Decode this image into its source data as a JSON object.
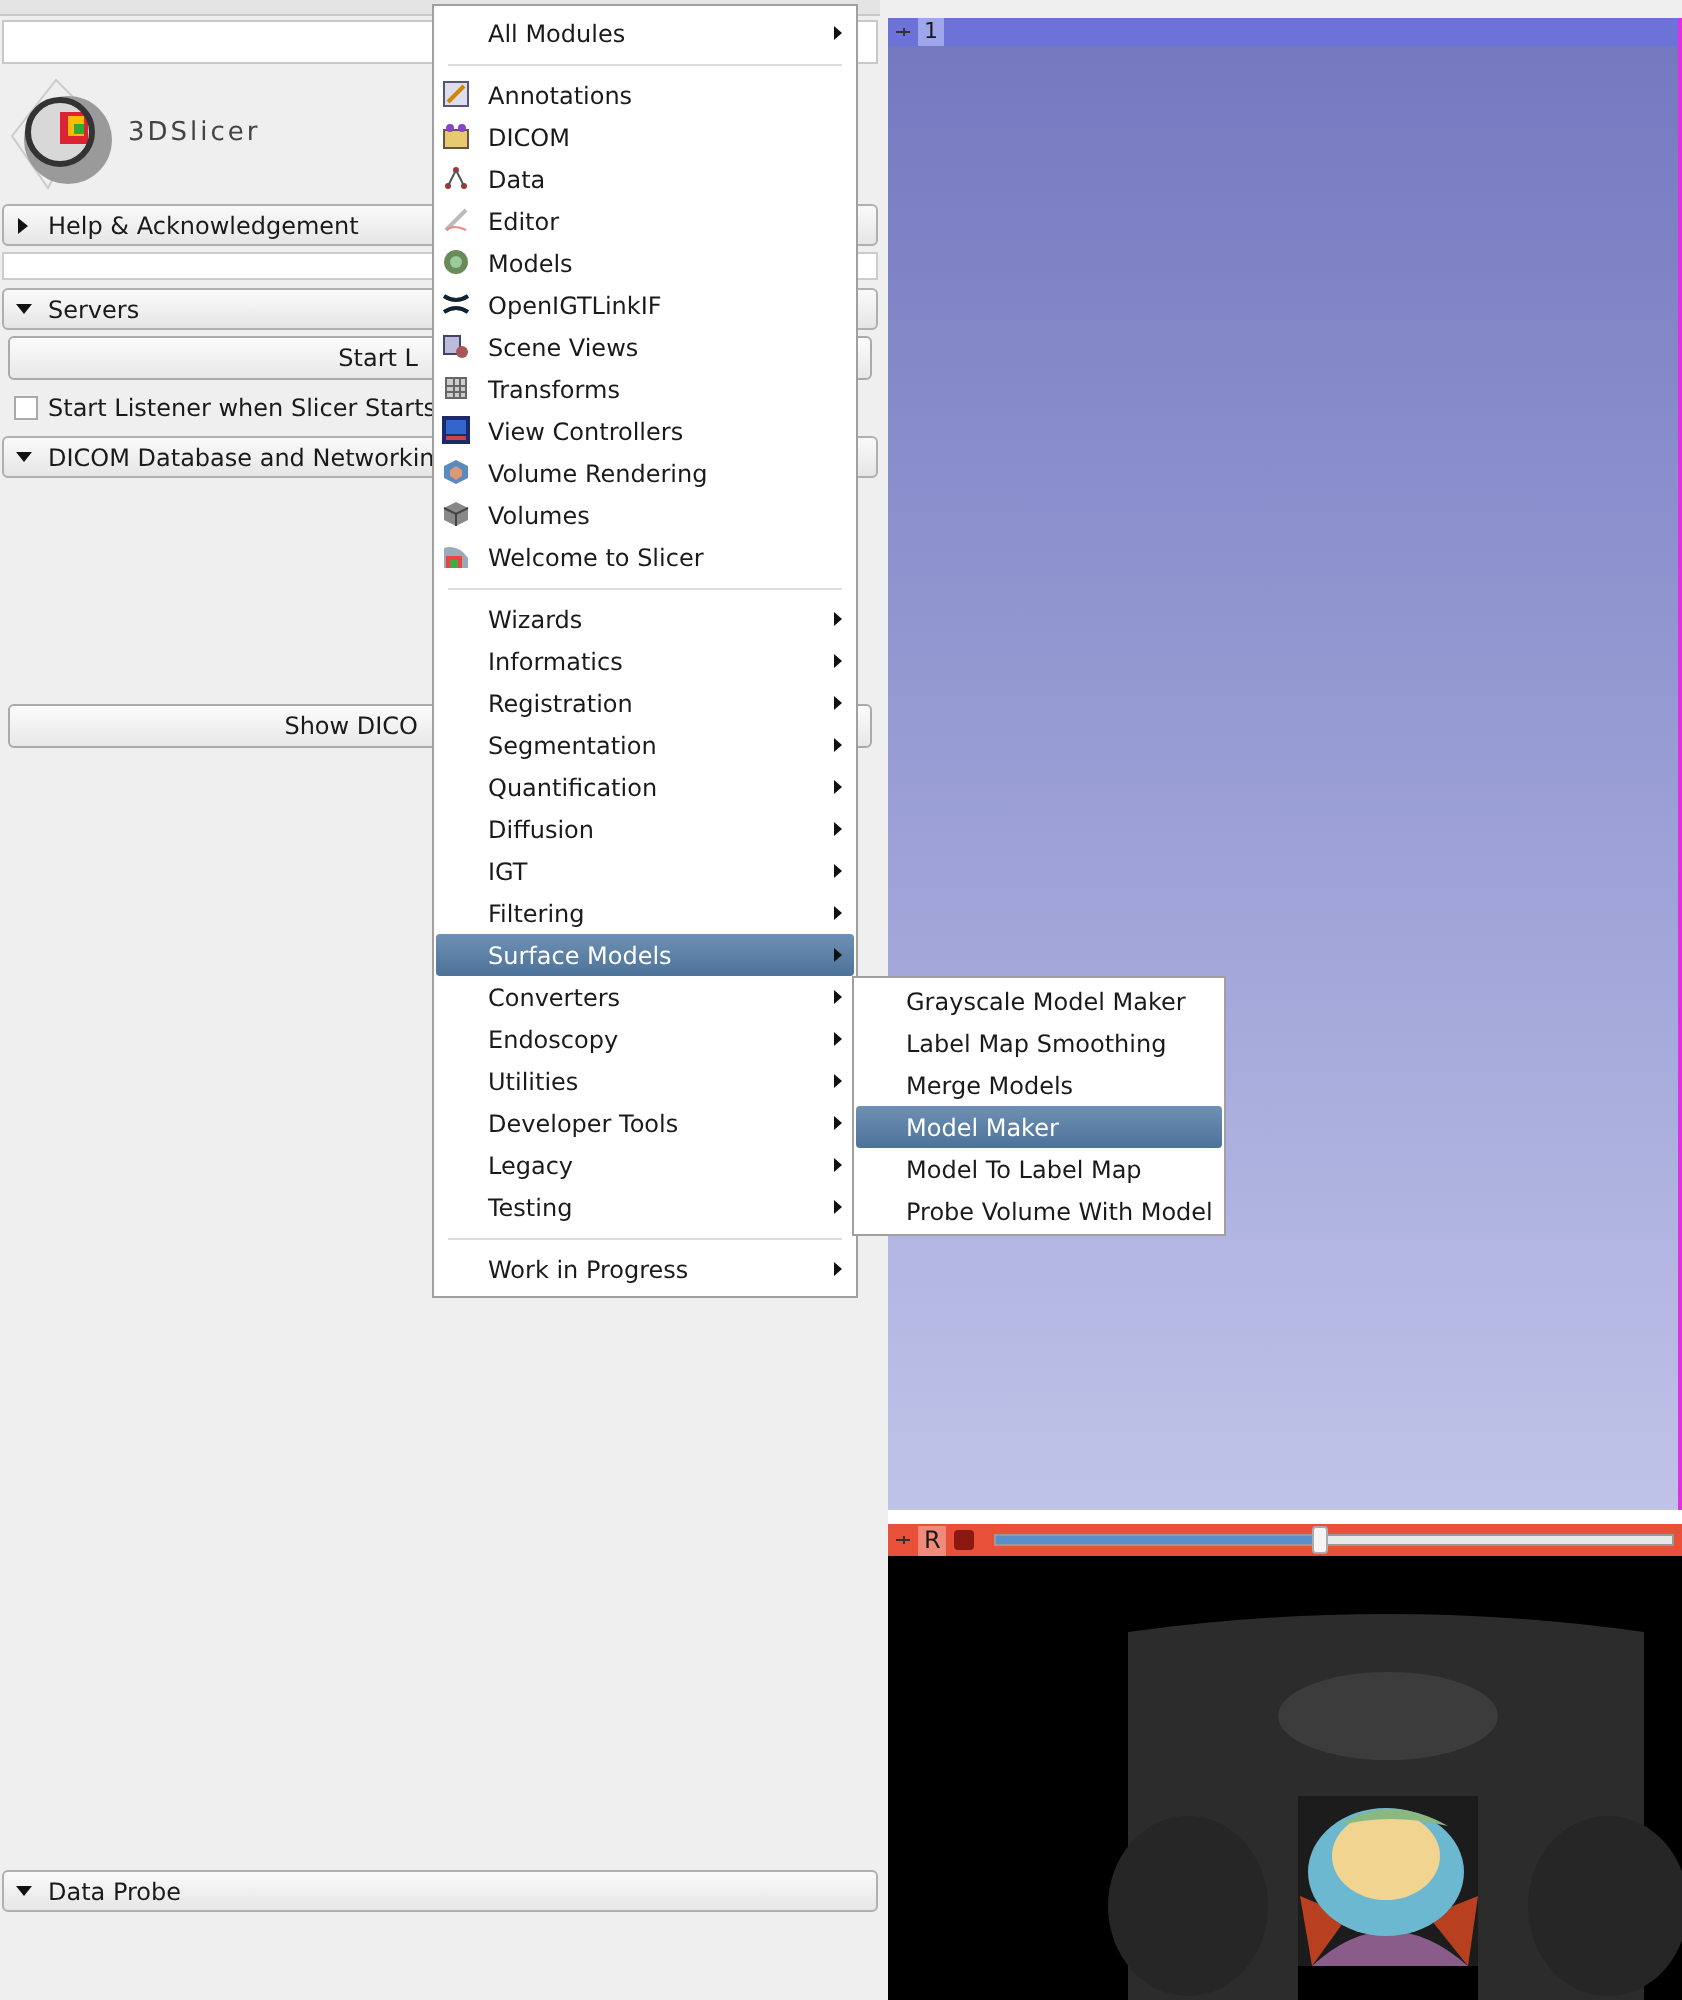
{
  "logo": {
    "text": "3DSlicer"
  },
  "panel": [
    {
      "kind": "section",
      "label": "Help & Acknowledgement",
      "expanded": false
    },
    {
      "kind": "spacer"
    },
    {
      "kind": "section",
      "label": "Servers",
      "expanded": true
    },
    {
      "kind": "button",
      "label": "Start L"
    },
    {
      "kind": "checkbox",
      "label": "Start Listener when Slicer Starts",
      "checked": false
    },
    {
      "kind": "section",
      "label": "DICOM Database and Networkin",
      "expanded": true
    },
    {
      "kind": "button",
      "label": "Show DICO"
    }
  ],
  "bottom_section": {
    "label": "Data Probe",
    "expanded": true
  },
  "menu": [
    {
      "kind": "category",
      "label": "All Modules",
      "selected": false
    },
    {
      "kind": "separator"
    },
    {
      "kind": "module",
      "label": "Annotations",
      "selected": false
    },
    {
      "kind": "module",
      "label": "DICOM",
      "selected": false
    },
    {
      "kind": "module",
      "label": "Data",
      "selected": false
    },
    {
      "kind": "module",
      "label": "Editor",
      "selected": false
    },
    {
      "kind": "module",
      "label": "Models",
      "selected": false
    },
    {
      "kind": "module",
      "label": "OpenIGTLinkIF",
      "selected": false
    },
    {
      "kind": "module",
      "label": "Scene Views",
      "selected": false
    },
    {
      "kind": "module",
      "label": "Transforms",
      "selected": false
    },
    {
      "kind": "module",
      "label": "View Controllers",
      "selected": false
    },
    {
      "kind": "module",
      "label": "Volume Rendering",
      "selected": false
    },
    {
      "kind": "module",
      "label": "Volumes",
      "selected": false
    },
    {
      "kind": "module",
      "label": "Welcome to Slicer",
      "selected": false
    },
    {
      "kind": "separator"
    },
    {
      "kind": "category",
      "label": "Wizards",
      "selected": false
    },
    {
      "kind": "category",
      "label": "Informatics",
      "selected": false
    },
    {
      "kind": "category",
      "label": "Registration",
      "selected": false
    },
    {
      "kind": "category",
      "label": "Segmentation",
      "selected": false
    },
    {
      "kind": "category",
      "label": "Quantification",
      "selected": false
    },
    {
      "kind": "category",
      "label": "Diffusion",
      "selected": false
    },
    {
      "kind": "category",
      "label": "IGT",
      "selected": false
    },
    {
      "kind": "category",
      "label": "Filtering",
      "selected": false
    },
    {
      "kind": "category",
      "label": "Surface Models",
      "selected": true
    },
    {
      "kind": "category",
      "label": "Converters",
      "selected": false
    },
    {
      "kind": "category",
      "label": "Endoscopy",
      "selected": false
    },
    {
      "kind": "category",
      "label": "Utilities",
      "selected": false
    },
    {
      "kind": "category",
      "label": "Developer Tools",
      "selected": false
    },
    {
      "kind": "category",
      "label": "Legacy",
      "selected": false
    },
    {
      "kind": "category",
      "label": "Testing",
      "selected": false
    },
    {
      "kind": "separator"
    },
    {
      "kind": "category",
      "label": "Work in Progress",
      "selected": false
    }
  ],
  "submenu": [
    {
      "label": "Grayscale Model Maker",
      "selected": false
    },
    {
      "label": "Label Map Smoothing",
      "selected": false
    },
    {
      "label": "Merge Models",
      "selected": false
    },
    {
      "label": "Model Maker",
      "selected": true
    },
    {
      "label": "Model To Label Map",
      "selected": false
    },
    {
      "label": "Probe Volume With Model",
      "selected": false
    }
  ],
  "view_3d": {
    "label": "1"
  },
  "slice_view": {
    "label": "R",
    "level": 0.48
  }
}
